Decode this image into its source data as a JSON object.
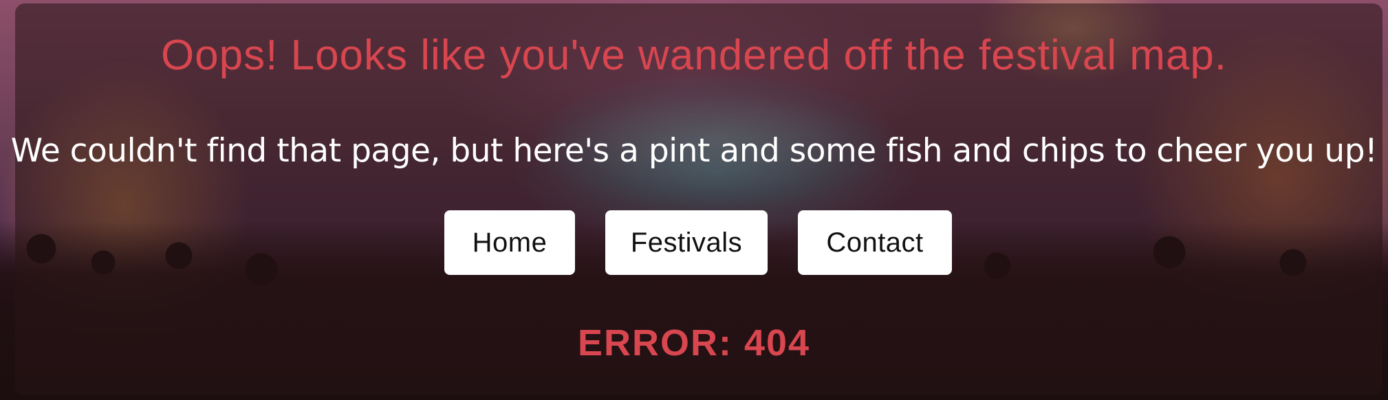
{
  "page": {
    "headline": "Oops! Looks like you've wandered off the festival map.",
    "message": "We couldn't find that page, but here's a pint and some fish and chips to cheer you up!",
    "error": "ERROR: 404"
  },
  "nav": {
    "home_label": "Home",
    "festivals_label": "Festivals",
    "contact_label": "Contact"
  },
  "colors": {
    "accent": "#d8464f",
    "button_bg": "#ffffff",
    "text_light": "#ffffff"
  }
}
